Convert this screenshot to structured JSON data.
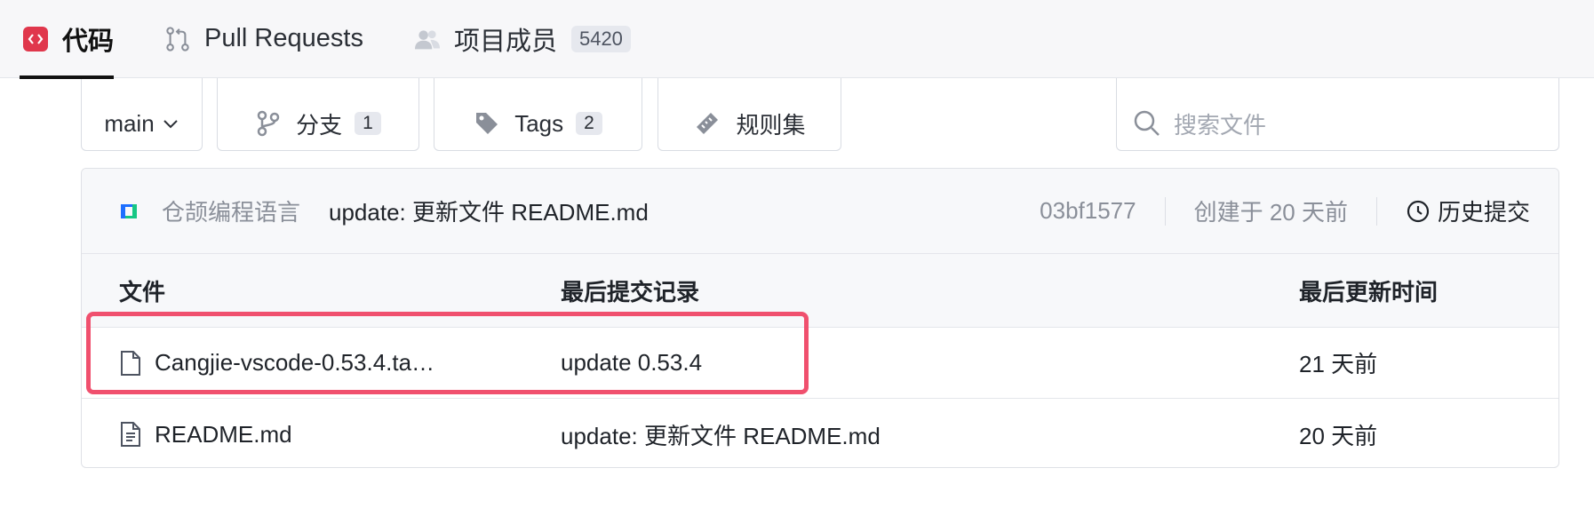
{
  "nav": {
    "tabs": [
      {
        "label": "代码",
        "icon": "code-icon",
        "active": true
      },
      {
        "label": "Pull Requests",
        "icon": "pull-request-icon"
      },
      {
        "label": "项目成员",
        "icon": "members-icon",
        "count": "5420"
      }
    ]
  },
  "toolbar": {
    "branch_select": "main",
    "branches_label": "分支",
    "branches_count": "1",
    "tags_label": "Tags",
    "tags_count": "2",
    "rules_label": "规则集",
    "search_placeholder": "搜索文件"
  },
  "commit": {
    "author": "仓颉编程语言",
    "message": "update: 更新文件 README.md",
    "hash": "03bf1577",
    "created": "创建于 20 天前",
    "history_label": "历史提交"
  },
  "table": {
    "headers": {
      "file": "文件",
      "commit": "最后提交记录",
      "time": "最后更新时间"
    },
    "rows": [
      {
        "name": "Cangjie-vscode-0.53.4.ta…",
        "icon": "file-icon",
        "commit": "update 0.53.4",
        "time": "21 天前"
      },
      {
        "name": "README.md",
        "icon": "text-file-icon",
        "commit": "update: 更新文件 README.md",
        "time": "20 天前"
      }
    ]
  },
  "colors": {
    "accent": "#e0374c",
    "highlight": "#f0506e"
  }
}
